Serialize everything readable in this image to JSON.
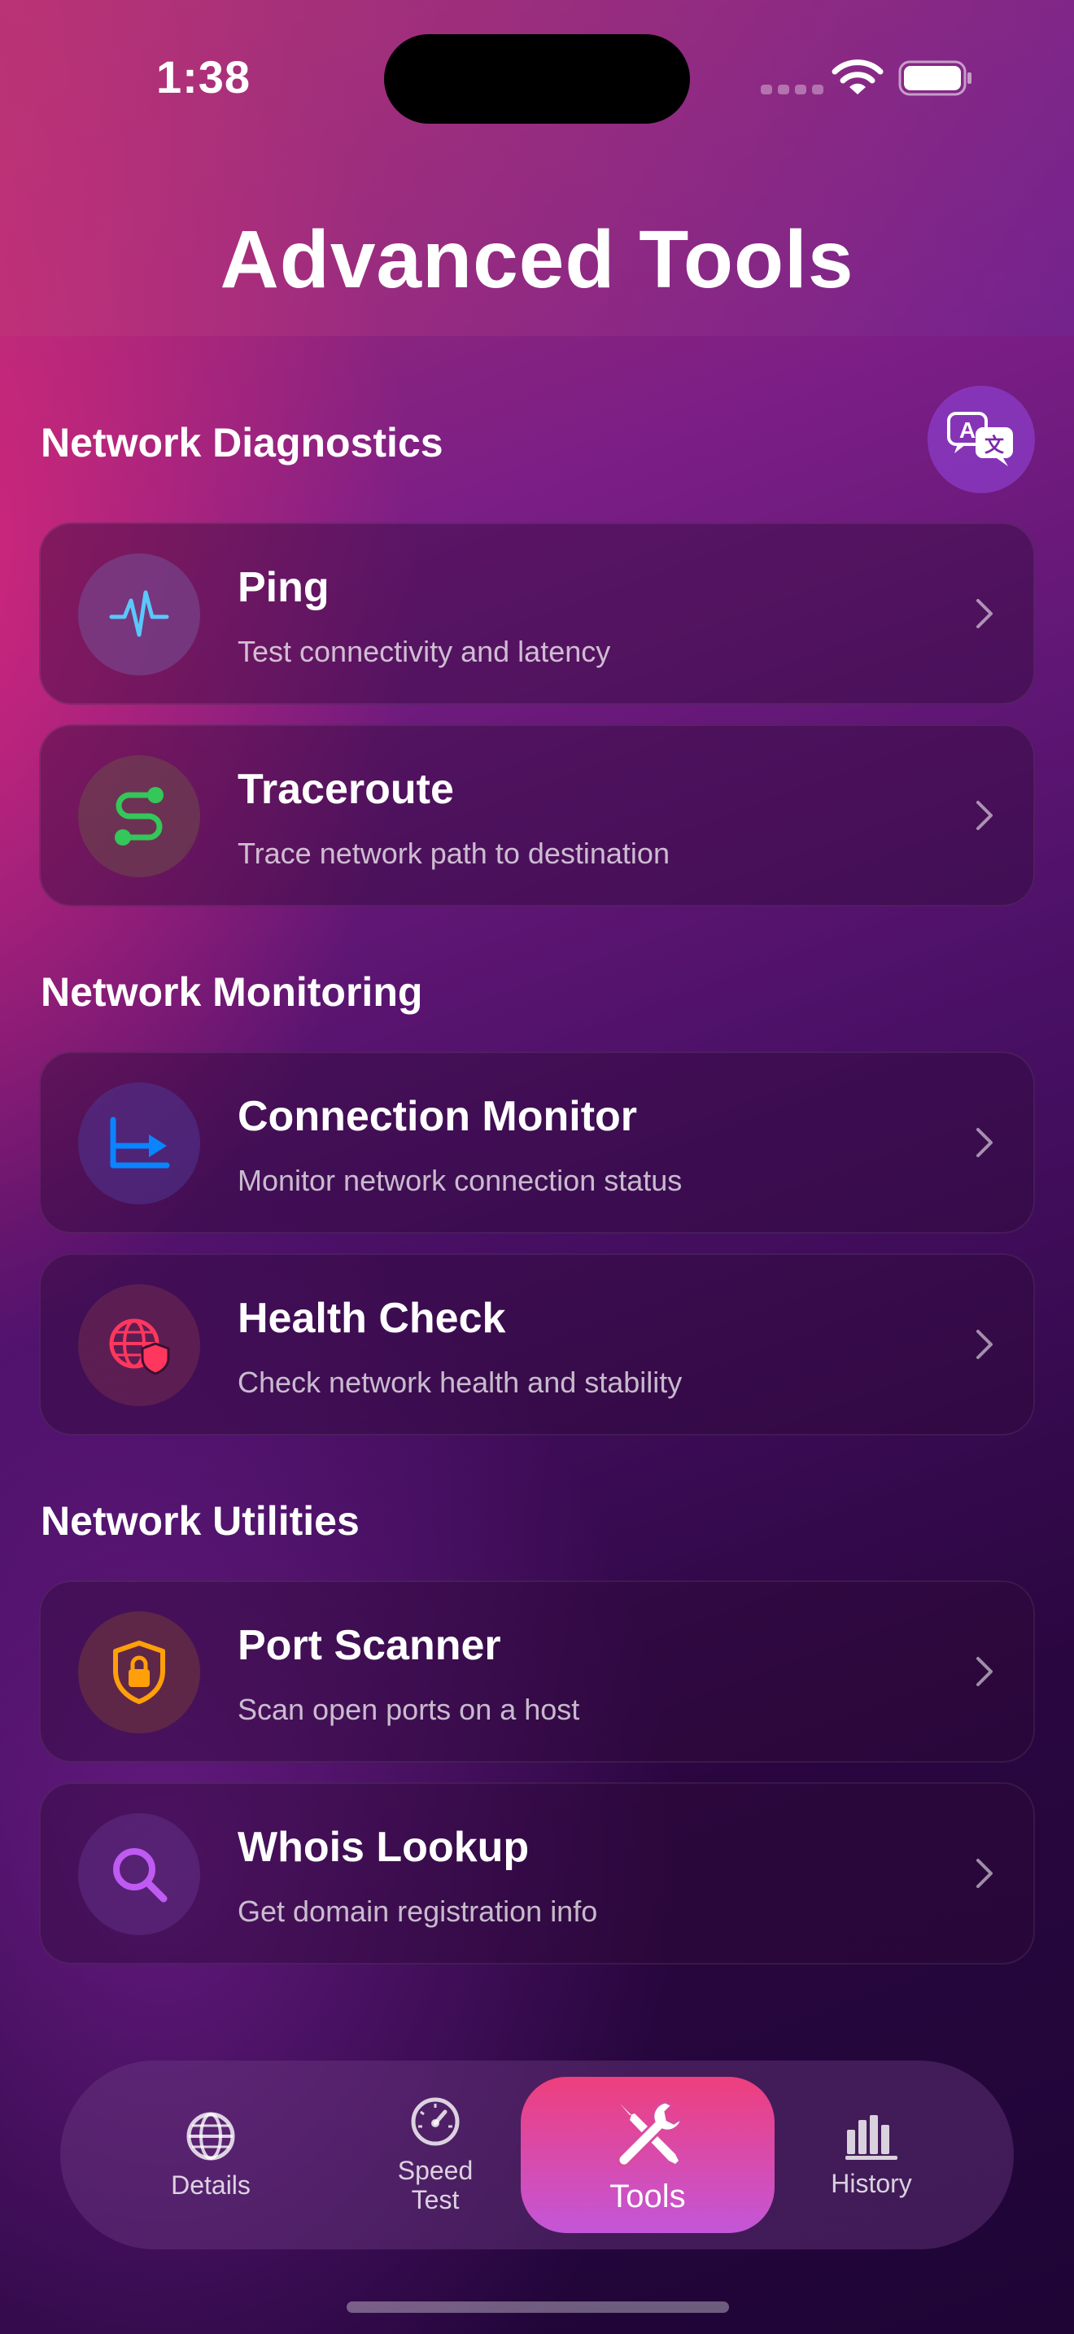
{
  "status_bar": {
    "time": "1:38"
  },
  "header": {
    "title": "Advanced Tools"
  },
  "sections": [
    {
      "title": "Network Diagnostics",
      "items": [
        {
          "title": "Ping",
          "subtitle": "Test connectivity and latency",
          "icon": "waveform-icon",
          "color": "#5ac8fa"
        },
        {
          "title": "Traceroute",
          "subtitle": "Trace network path to destination",
          "icon": "route-icon",
          "color": "#34c759"
        }
      ]
    },
    {
      "title": "Network Monitoring",
      "items": [
        {
          "title": "Connection Monitor",
          "subtitle": "Monitor network connection status",
          "icon": "chart-arrow-icon",
          "color": "#0a84ff"
        },
        {
          "title": "Health Check",
          "subtitle": "Check network health and stability",
          "icon": "globe-shield-icon",
          "color": "#ff375f"
        }
      ]
    },
    {
      "title": "Network Utilities",
      "items": [
        {
          "title": "Port Scanner",
          "subtitle": "Scan open ports on a host",
          "icon": "lock-shield-icon",
          "color": "#ff9f0a"
        },
        {
          "title": "Whois Lookup",
          "subtitle": "Get domain registration info",
          "icon": "magnifier-icon",
          "color": "#bf5af2"
        }
      ]
    }
  ],
  "tabbar": {
    "tabs": [
      {
        "label": "Details",
        "icon": "globe-icon"
      },
      {
        "label": "Speed\nTest",
        "icon": "speedometer-icon"
      },
      {
        "label": "Tools",
        "icon": "tools-icon",
        "active": true
      },
      {
        "label": "History",
        "icon": "bar-chart-icon"
      }
    ]
  }
}
